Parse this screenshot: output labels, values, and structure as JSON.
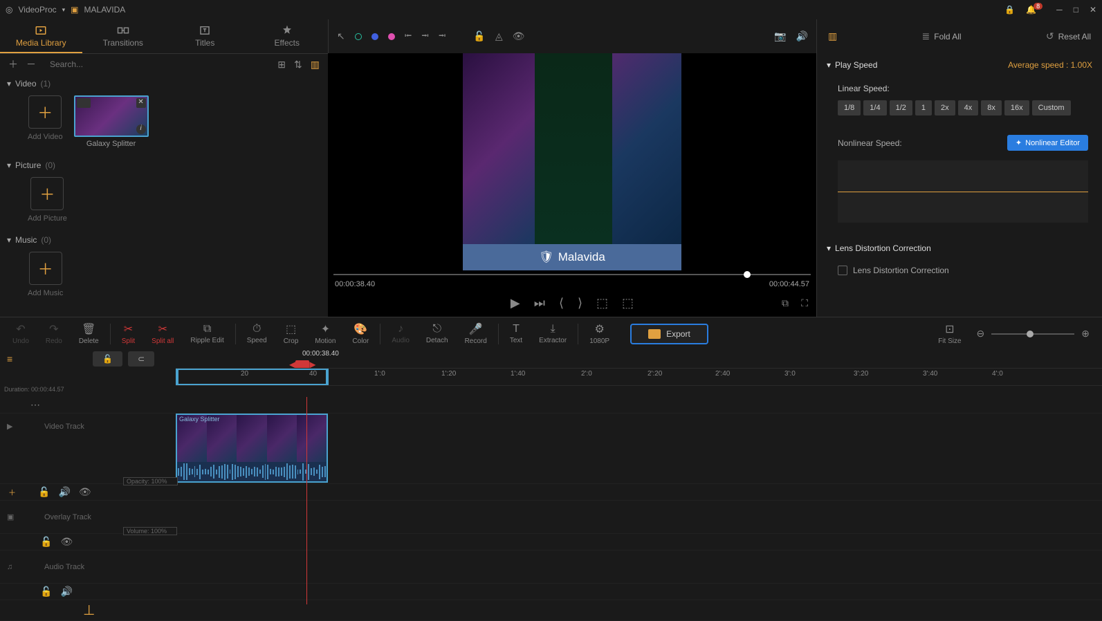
{
  "app": {
    "name": "VideoProc",
    "project": "MALAVIDA",
    "notif_count": "8"
  },
  "tabs": {
    "media": "Media Library",
    "transitions": "Transitions",
    "titles": "Titles",
    "effects": "Effects"
  },
  "search": {
    "placeholder": "Search..."
  },
  "sections": {
    "video": {
      "label": "Video",
      "count": "(1)",
      "add": "Add Video"
    },
    "picture": {
      "label": "Picture",
      "count": "(0)",
      "add": "Add Picture"
    },
    "music": {
      "label": "Music",
      "count": "(0)",
      "add": "Add Music"
    }
  },
  "clip": {
    "name": "Galaxy Splitter"
  },
  "preview": {
    "watermark": "Malavida",
    "current": "00:00:38.40",
    "total": "00:00:44.57"
  },
  "rightPanel": {
    "foldAll": "Fold All",
    "resetAll": "Reset All",
    "playSpeed": {
      "title": "Play Speed",
      "avg": "Average speed : 1.00X"
    },
    "linear": "Linear Speed:",
    "speeds": [
      "1/8",
      "1/4",
      "1/2",
      "1",
      "2x",
      "4x",
      "8x",
      "16x",
      "Custom"
    ],
    "nonlinear": {
      "label": "Nonlinear Speed:",
      "btn": "Nonlinear Editor"
    },
    "lens": {
      "title": "Lens Distortion Correction",
      "chk": "Lens Distortion Correction"
    }
  },
  "tools": {
    "undo": "Undo",
    "redo": "Redo",
    "delete": "Delete",
    "split": "Split",
    "splitall": "Split all",
    "ripple": "Ripple Edit",
    "speed": "Speed",
    "crop": "Crop",
    "motion": "Motion",
    "color": "Color",
    "audio": "Audio",
    "detach": "Detach",
    "record": "Record",
    "text": "Text",
    "extractor": "Extractor",
    "res": "1080P",
    "export": "Export",
    "fitsize": "Fit Size"
  },
  "timeline": {
    "playhead_time": "00:00:38.40",
    "duration_lbl": "Duration:",
    "duration": "00:00:44.57",
    "marks": [
      "20",
      "40",
      "1':0",
      "1':20",
      "1':40",
      "2':0",
      "2':20",
      "2':40",
      "3':0",
      "3':20",
      "3':40",
      "4':0"
    ],
    "videoTrack": "Video Track",
    "overlayTrack": "Overlay Track",
    "audioTrack": "Audio Track",
    "opacity": "Opacity: 100%",
    "volume": "Volume: 100%"
  }
}
